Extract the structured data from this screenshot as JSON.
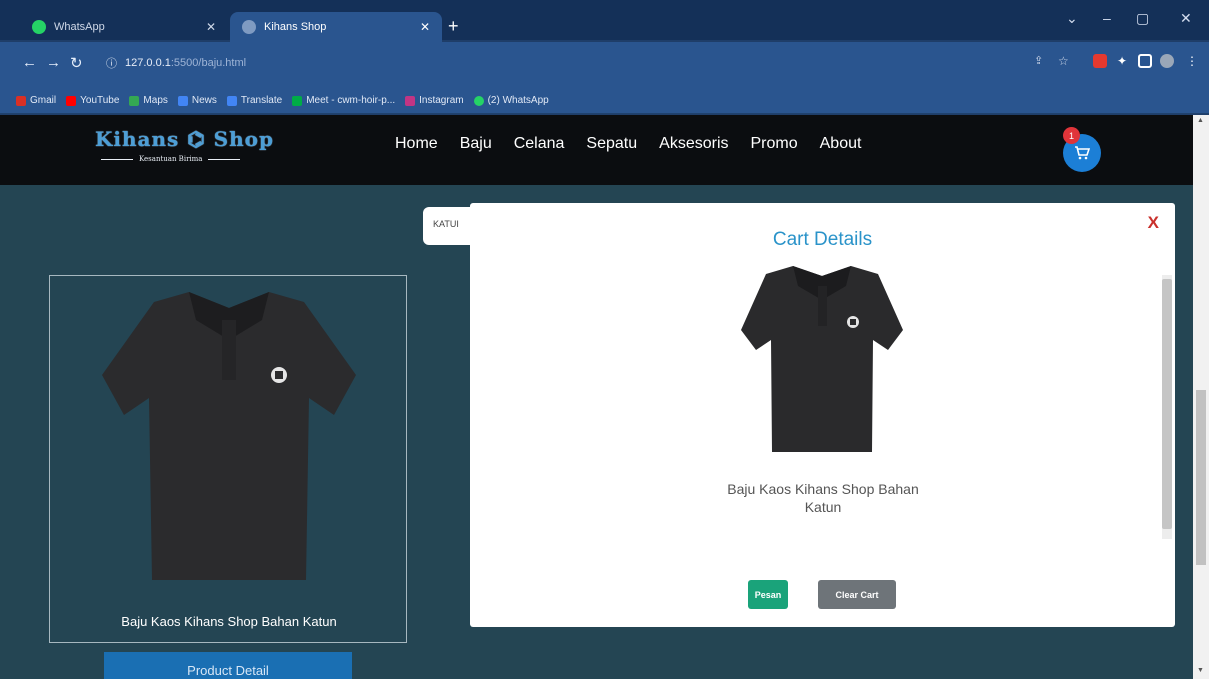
{
  "browser": {
    "tabs": [
      {
        "title": "WhatsApp",
        "icon": "whatsapp-icon"
      },
      {
        "title": "Kihans Shop",
        "icon": "globe-icon"
      }
    ],
    "address": {
      "host": "127.0.0.1",
      "rest": ":5500/baju.html"
    },
    "bookmarks": [
      {
        "label": "Gmail",
        "icon": "gmail-icon",
        "color": "#d93025"
      },
      {
        "label": "YouTube",
        "icon": "youtube-icon",
        "color": "#ff0000"
      },
      {
        "label": "Maps",
        "icon": "maps-icon",
        "color": "#34a853"
      },
      {
        "label": "News",
        "icon": "news-icon",
        "color": "#4285f4"
      },
      {
        "label": "Translate",
        "icon": "translate-icon",
        "color": "#4285f4"
      },
      {
        "label": "Meet - cwm-hoir-p...",
        "icon": "meet-icon",
        "color": "#00ac47"
      },
      {
        "label": "Instagram",
        "icon": "instagram-icon",
        "color": "#c13584"
      },
      {
        "label": "(2) WhatsApp",
        "icon": "whatsapp-icon",
        "color": "#25d366"
      }
    ]
  },
  "site": {
    "logo": {
      "main": "Kihans ⌬ Shop",
      "sub": "Kesantuan Birima"
    },
    "nav": [
      "Home",
      "Baju",
      "Celana",
      "Sepatu",
      "Aksesoris",
      "Promo",
      "About"
    ],
    "cart_count": "1",
    "search_partial": "KATUI",
    "product": {
      "name": "Baju Kaos Kihans Shop Bahan Katun",
      "detail_button": "Product Detail"
    },
    "colors": {
      "header": "#0b0d10",
      "page": "#244553",
      "accent": "#1c7fd6"
    }
  },
  "modal": {
    "close": "X",
    "title": "Cart Details",
    "item_name": "Baju Kaos Kihans Shop Bahan Katun",
    "buttons": {
      "order": "Pesan",
      "clear": "Clear Cart"
    }
  }
}
